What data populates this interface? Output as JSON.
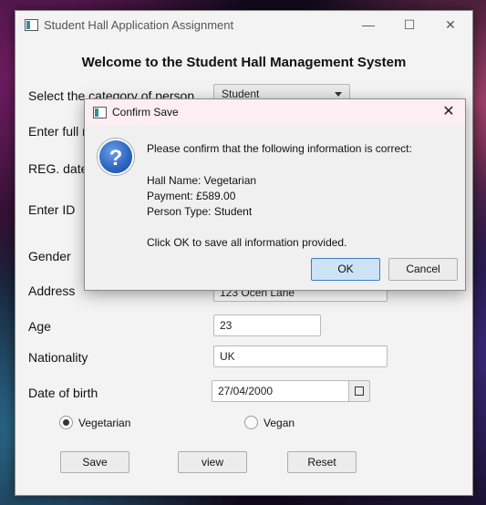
{
  "window": {
    "title": "Student Hall Application Assignment",
    "minimize": "—",
    "maximize": "☐",
    "close": "✕"
  },
  "form": {
    "heading": "Welcome to the Student Hall Management System",
    "category_label": "Select the category of person",
    "category_value": "Student",
    "name_label": "Enter full n",
    "reg_date_label": "REG. date",
    "id_label": "Enter ID",
    "gender_label": "Gender",
    "address_label": "Address",
    "address_value": "123 Ocen Lane",
    "age_label": "Age",
    "age_value": "23",
    "nationality_label": "Nationality",
    "nationality_value": "UK",
    "dob_label": "Date of birth",
    "dob_value": "27/04/2000",
    "diet_options": [
      {
        "label": "Vegetarian",
        "selected": true
      },
      {
        "label": "Vegan",
        "selected": false
      }
    ],
    "save_label": "Save",
    "view_label": "view",
    "reset_label": "Reset"
  },
  "dialog": {
    "title": "Confirm Save",
    "close": "✕",
    "icon": "question-icon",
    "icon_glyph": "?",
    "prompt": "Please confirm that the following information is correct:",
    "hall_name": "Hall Name: Vegetarian",
    "payment": "Payment: £589.00",
    "person_type": "Person Type: Student",
    "footer": "Click OK to save all information provided.",
    "ok_label": "OK",
    "cancel_label": "Cancel"
  }
}
